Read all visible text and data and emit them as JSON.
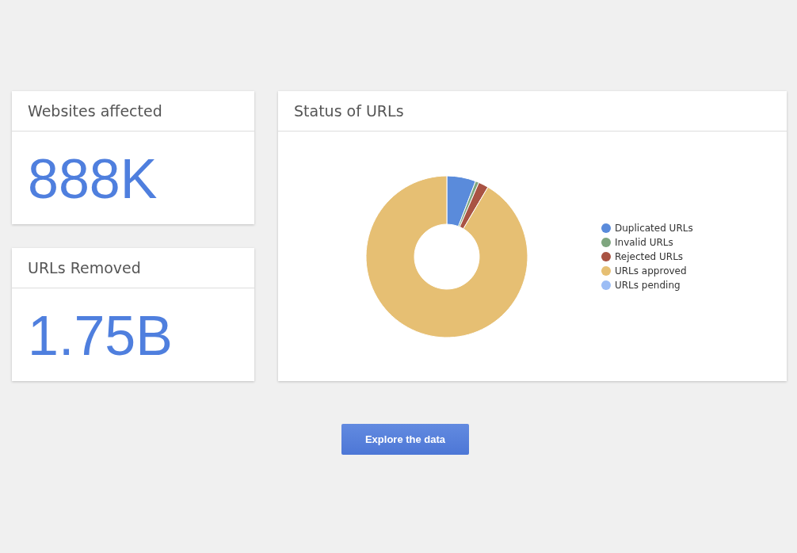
{
  "stats": [
    {
      "title": "Websites affected",
      "value": "888K"
    },
    {
      "title": "URLs Removed",
      "value": "1.75B"
    }
  ],
  "status_card": {
    "title": "Status of URLs",
    "legend": [
      {
        "label": "Duplicated URLs",
        "color": "#5a8bdb"
      },
      {
        "label": "Invalid URLs",
        "color": "#7fa67f"
      },
      {
        "label": "Rejected URLs",
        "color": "#a95343"
      },
      {
        "label": "URLs approved",
        "color": "#e6bf73"
      },
      {
        "label": "URLs pending",
        "color": "#9cbdf5"
      }
    ]
  },
  "button": {
    "label": "Explore the data"
  }
}
